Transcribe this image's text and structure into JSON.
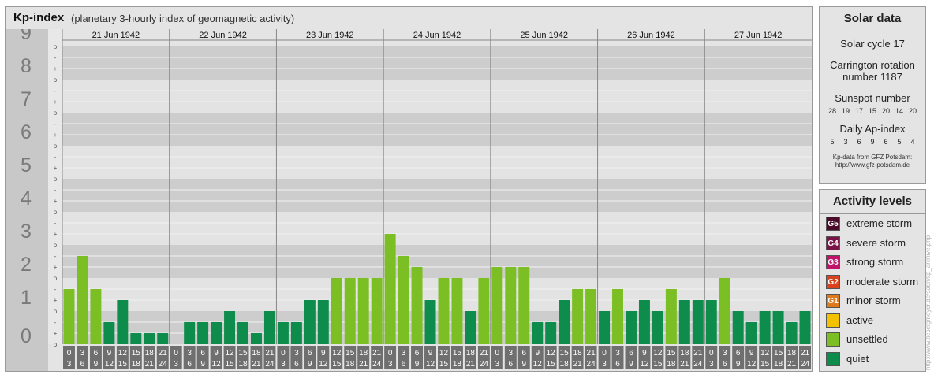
{
  "header": {
    "title": "Kp-index",
    "subtitle": "(planetary 3-hourly index of geomagnetic activity)"
  },
  "chart_data": {
    "type": "bar",
    "ylim": [
      0,
      9
    ],
    "y_ticks": [
      "0",
      "1",
      "2",
      "3",
      "4",
      "5",
      "6",
      "7",
      "8",
      "9"
    ],
    "y_subticks": [
      "+",
      "o",
      "-"
    ],
    "days": [
      "21 Jun 1942",
      "22 Jun 1942",
      "23 Jun 1942",
      "24 Jun 1942",
      "25 Jun 1942",
      "26 Jun 1942",
      "27 Jun 1942"
    ],
    "interval_start": [
      "0",
      "3",
      "6",
      "9",
      "12",
      "15",
      "18",
      "21"
    ],
    "interval_end": [
      "3",
      "6",
      "9",
      "12",
      "15",
      "18",
      "21",
      "24"
    ],
    "values": [
      1.667,
      2.667,
      1.667,
      0.667,
      1.333,
      0.333,
      0.333,
      0.333,
      0.0,
      0.667,
      0.667,
      0.667,
      1.0,
      0.667,
      0.333,
      1.0,
      0.667,
      0.667,
      1.333,
      1.333,
      2.0,
      2.0,
      2.0,
      2.0,
      3.333,
      2.667,
      2.333,
      1.333,
      2.0,
      2.0,
      1.0,
      2.0,
      2.333,
      2.333,
      2.333,
      0.667,
      0.667,
      1.333,
      1.667,
      1.667,
      1.0,
      1.667,
      1.0,
      1.333,
      1.0,
      1.667,
      1.333,
      1.333,
      1.333,
      2.0,
      1.0,
      0.667,
      1.0,
      1.0,
      0.667,
      1.0
    ],
    "colors": {
      "quiet": "#0d8c4b",
      "unsettled": "#7bbf24",
      "band_dark": "#cdcdcd",
      "band_light": "#e3e3e3",
      "axis_bg": "#c8c8c8",
      "time_box": "#6f6f6f"
    }
  },
  "solar": {
    "title": "Solar data",
    "cycle": "Solar cycle 17",
    "carrington_line1": "Carrington rotation",
    "carrington_line2": "number 1187",
    "sunspot_label": "Sunspot number",
    "sunspot_values": [
      "28",
      "19",
      "17",
      "15",
      "20",
      "14",
      "20"
    ],
    "ap_label": "Daily Ap-index",
    "ap_values": [
      "5",
      "3",
      "6",
      "9",
      "6",
      "5",
      "4"
    ],
    "credit_line1": "Kp-data from GFZ Potsdam:",
    "credit_line2": "http://www.gfz-potsdam.de"
  },
  "activity": {
    "title": "Activity levels",
    "levels": [
      {
        "code": "G5",
        "label": "extreme storm",
        "color": "#4a0a2a"
      },
      {
        "code": "G4",
        "label": "severe storm",
        "color": "#7a1446"
      },
      {
        "code": "G3",
        "label": "strong storm",
        "color": "#c0136a"
      },
      {
        "code": "G2",
        "label": "moderate storm",
        "color": "#d8421c"
      },
      {
        "code": "G1",
        "label": "minor storm",
        "color": "#e0781c"
      },
      {
        "code": "",
        "label": "active",
        "color": "#f2c200"
      },
      {
        "code": "",
        "label": "unsettled",
        "color": "#7bbf24"
      },
      {
        "code": "",
        "label": "quiet",
        "color": "#0d8c4b"
      }
    ]
  },
  "watermark": "http://www.fieselgmeyer.de/sabn/kp_archive.php"
}
